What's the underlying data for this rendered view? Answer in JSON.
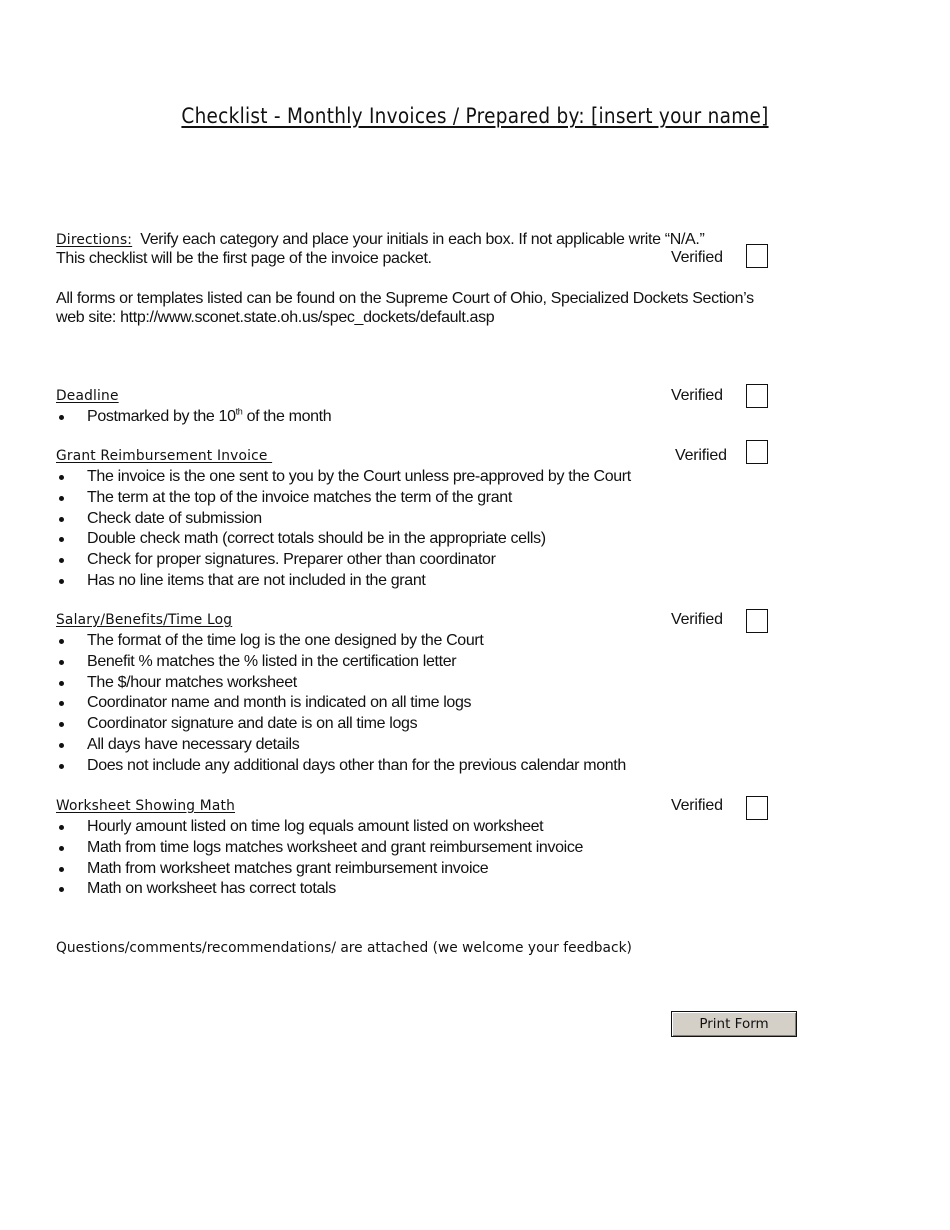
{
  "title": "Checklist - Monthly Invoices / Prepared by: [insert your name]",
  "directions": {
    "label": "Directions:",
    "text_line1": " Verify each category and place your initials in each box.  If not applicable write “N/A.”",
    "text_line2": "This checklist will be the first page of the invoice packet.",
    "verified_label": "Verified"
  },
  "forms_note": {
    "line1": "All forms or templates listed can be found on the Supreme Court of Ohio, Specialized Dockets Section’s",
    "line2": "web site: http://www.sconet.state.oh.us/spec_dockets/default.asp"
  },
  "sections": [
    {
      "heading": "Deadline",
      "verified_label": "Verified",
      "items": [
        {
          "text_before": "Postmarked by the 10",
          "sup": "th",
          "text_after": " of the month"
        }
      ]
    },
    {
      "heading": "Grant Reimbursement Invoice ",
      "verified_label": "Verified",
      "items": [
        "The invoice is the one sent to you by the Court unless pre-approved by the Court",
        "The term at the top of the invoice matches the term of the grant",
        "Check date of submission",
        "Double check math (correct totals should be in the appropriate cells)",
        "Check for proper signatures. Preparer other than coordinator",
        "Has no line items that are not included in the grant"
      ]
    },
    {
      "heading": "Salary/Benefits/Time Log",
      "verified_label": "Verified",
      "items": [
        "The format of the time log is the one designed by the Court",
        "Benefit % matches the % listed in the certification letter",
        "The $/hour matches worksheet",
        "Coordinator name and month is indicated on all time logs",
        "Coordinator signature and date is on all time logs",
        "All days have necessary details",
        "Does not include any additional days other than for the previous calendar month"
      ]
    },
    {
      "heading": "Worksheet Showing Math",
      "verified_label": "Verified",
      "items": [
        "Hourly amount listed on time log equals amount listed on worksheet",
        "Math from time logs matches worksheet and grant reimbursement invoice",
        "Math from worksheet matches grant reimbursement invoice",
        "Math on worksheet has correct totals"
      ]
    }
  ],
  "feedback": "Questions/comments/recommendations/ are attached (we welcome your feedback)",
  "print_button": "Print Form"
}
